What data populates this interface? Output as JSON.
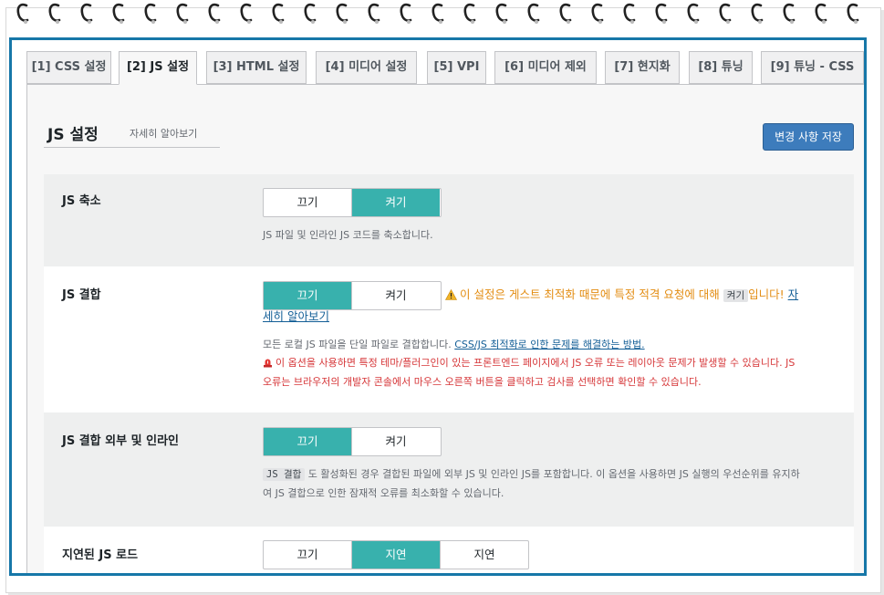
{
  "tabs": [
    {
      "label": "[1] CSS 설정",
      "active": false
    },
    {
      "label": "[2] JS 설정",
      "active": true
    },
    {
      "label": "[3] HTML 설정",
      "active": false
    },
    {
      "label": "[4] 미디어 설정",
      "active": false
    },
    {
      "label": "[5] VPI",
      "active": false
    },
    {
      "label": "[6] 미디어 제외",
      "active": false
    },
    {
      "label": "[7] 현지화",
      "active": false
    },
    {
      "label": "[8] 튜닝",
      "active": false
    },
    {
      "label": "[9] 튜닝 - CSS",
      "active": false
    }
  ],
  "header": {
    "title": "JS 설정",
    "learn_more": "자세히 알아보기",
    "save_label": "변경 사항 저장"
  },
  "settings": {
    "js_minify": {
      "label": "JS 축소",
      "options": [
        "끄기",
        "켜기"
      ],
      "selected": "켜기",
      "desc": "JS 파일 및 인라인 JS 코드를 축소합니다."
    },
    "js_combine": {
      "label": "JS 결합",
      "options": [
        "끄기",
        "켜기"
      ],
      "selected": "끄기",
      "warning_pre": "이 설정은 게스트 최적화 때문에 특정 적격 요청에 대해",
      "warning_code": "켜기",
      "warning_post": "입니다!",
      "warning_link": "자세히 알아보기",
      "warning_link_cont": "세히 알아보기",
      "warning_link_start": "자",
      "desc_pre": "모든 로컬 JS 파일을 단일 파일로 결합합니다.",
      "desc_link": "CSS/JS 최적화로 인한 문제를 해결하는 방법.",
      "danger_line1": "이 옵션을 사용하면 특정 테마/플러그인이 있는 프론트엔드 페이지에서 JS 오류 또는 레이아웃 문제가 발생할 수 있습니다. JS",
      "danger_line2": "오류는 브라우저의 개발자 콘솔에서 마우스 오른쪽 버튼을 클릭하고 검사를 선택하면 확인할 수 있습니다."
    },
    "js_combine_external": {
      "label": "JS 결합 외부 및 인라인",
      "options": [
        "끄기",
        "켜기"
      ],
      "selected": "끄기",
      "desc_code": "JS 결합",
      "desc_line1": "도 활성화된 경우 결합된 파일에 외부 JS 및 인라인 JS를 포함합니다. 이 옵션을 사용하면 JS 실행의 우선순위를 유지하",
      "desc_line2": "여 JS 결합으로 인한 잠재적 오류를 최소화할 수 있습니다."
    },
    "js_deferred": {
      "label": "지연된 JS 로드",
      "options": [
        "끄기",
        "지연",
        "지연"
      ],
      "selected_index": 1
    }
  },
  "colors": {
    "frame": "#1677a8",
    "toggle_on": "#38b1ad",
    "save_button": "#3d7cbc",
    "warning": "#e38d13",
    "danger": "#d63638"
  }
}
